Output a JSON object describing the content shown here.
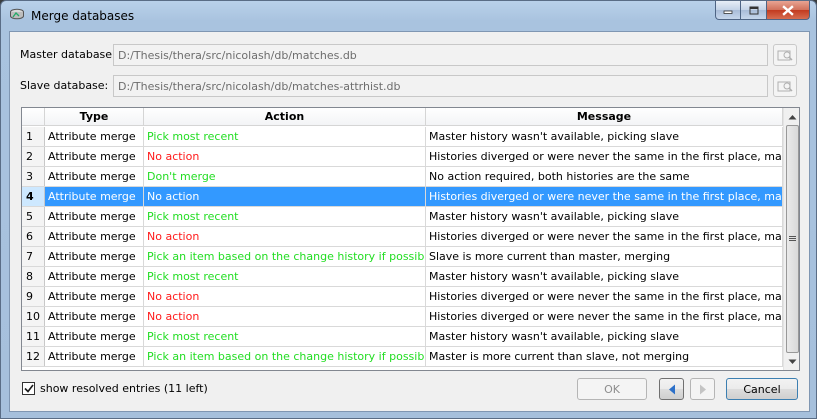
{
  "window": {
    "title": "Merge databases",
    "icon": "database-merge-icon"
  },
  "fields": {
    "master_label": "Master database:",
    "master_value": "D:/Thesis/thera/src/nicolash/db/matches.db",
    "slave_label": "Slave database:",
    "slave_value": "D:/Thesis/thera/src/nicolash/db/matches-attrhist.db"
  },
  "table": {
    "headers": {
      "type": "Type",
      "action": "Action",
      "message": "Message"
    },
    "selected_row": 4,
    "rows": [
      {
        "num": "1",
        "type": "Attribute merge",
        "action": "Pick most recent",
        "action_color": "green",
        "message": "Master history wasn't available, picking slave"
      },
      {
        "num": "2",
        "type": "Attribute merge",
        "action": "No action",
        "action_color": "red",
        "message": "Histories diverged or were never the same in the first place, manu..."
      },
      {
        "num": "3",
        "type": "Attribute merge",
        "action": "Don't merge",
        "action_color": "green",
        "message": "No action required, both histories are the same"
      },
      {
        "num": "4",
        "type": "Attribute merge",
        "action": "No action",
        "action_color": "red",
        "message": "Histories diverged or were never the same in the first place, manu..."
      },
      {
        "num": "5",
        "type": "Attribute merge",
        "action": "Pick most recent",
        "action_color": "green",
        "message": "Master history wasn't available, picking slave"
      },
      {
        "num": "6",
        "type": "Attribute merge",
        "action": "No action",
        "action_color": "red",
        "message": "Histories diverged or were never the same in the first place, manu..."
      },
      {
        "num": "7",
        "type": "Attribute merge",
        "action": "Pick an item based on the change history if possible",
        "action_color": "green",
        "message": "Slave is more current than master, merging"
      },
      {
        "num": "8",
        "type": "Attribute merge",
        "action": "Pick most recent",
        "action_color": "green",
        "message": "Master history wasn't available, picking slave"
      },
      {
        "num": "9",
        "type": "Attribute merge",
        "action": "No action",
        "action_color": "red",
        "message": "Histories diverged or were never the same in the first place, manu..."
      },
      {
        "num": "10",
        "type": "Attribute merge",
        "action": "No action",
        "action_color": "red",
        "message": "Histories diverged or were never the same in the first place, manu..."
      },
      {
        "num": "11",
        "type": "Attribute merge",
        "action": "Pick most recent",
        "action_color": "green",
        "message": "Master history wasn't available, picking slave"
      },
      {
        "num": "12",
        "type": "Attribute merge",
        "action": "Pick an item based on the change history if possible",
        "action_color": "green",
        "message": "Master is more current than slave, not merging"
      }
    ]
  },
  "footer": {
    "show_resolved_label": "show resolved entries (11 left)",
    "show_resolved_checked": true,
    "ok_label": "OK",
    "cancel_label": "Cancel"
  },
  "colors": {
    "action_green": "#22dd22",
    "action_red": "#ff1a1a",
    "selection": "#3399ff"
  }
}
